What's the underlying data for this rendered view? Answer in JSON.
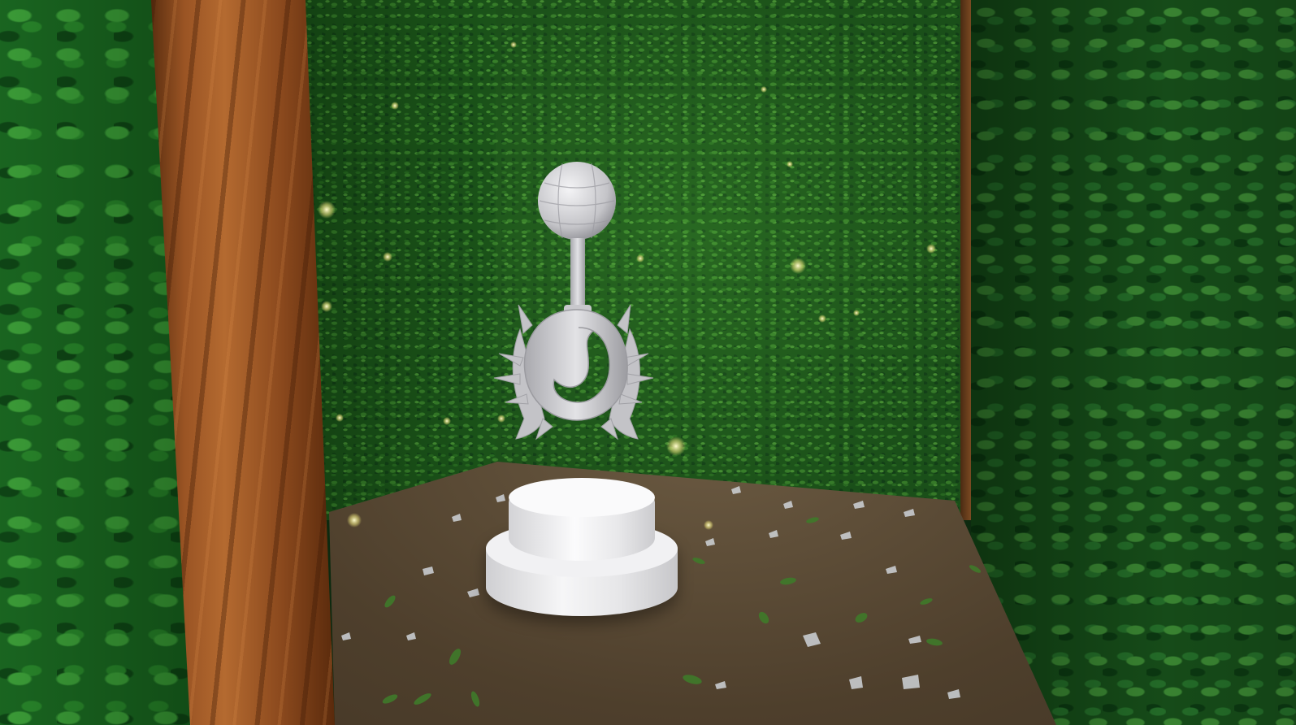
{
  "scene": {
    "colors": {
      "hedge_back": "#1e5a1c",
      "hedge_side": "#1b6a22",
      "trunk": "#9a5424",
      "floor": "#4e3f2c",
      "pedestal": "#f1f1f3",
      "trophy": "#c9c9cc",
      "firefly": "#f4f2a0"
    },
    "icons": {
      "trophy": "crescent-spiked-trophy-icon",
      "pedestal": "round-pedestal"
    }
  }
}
